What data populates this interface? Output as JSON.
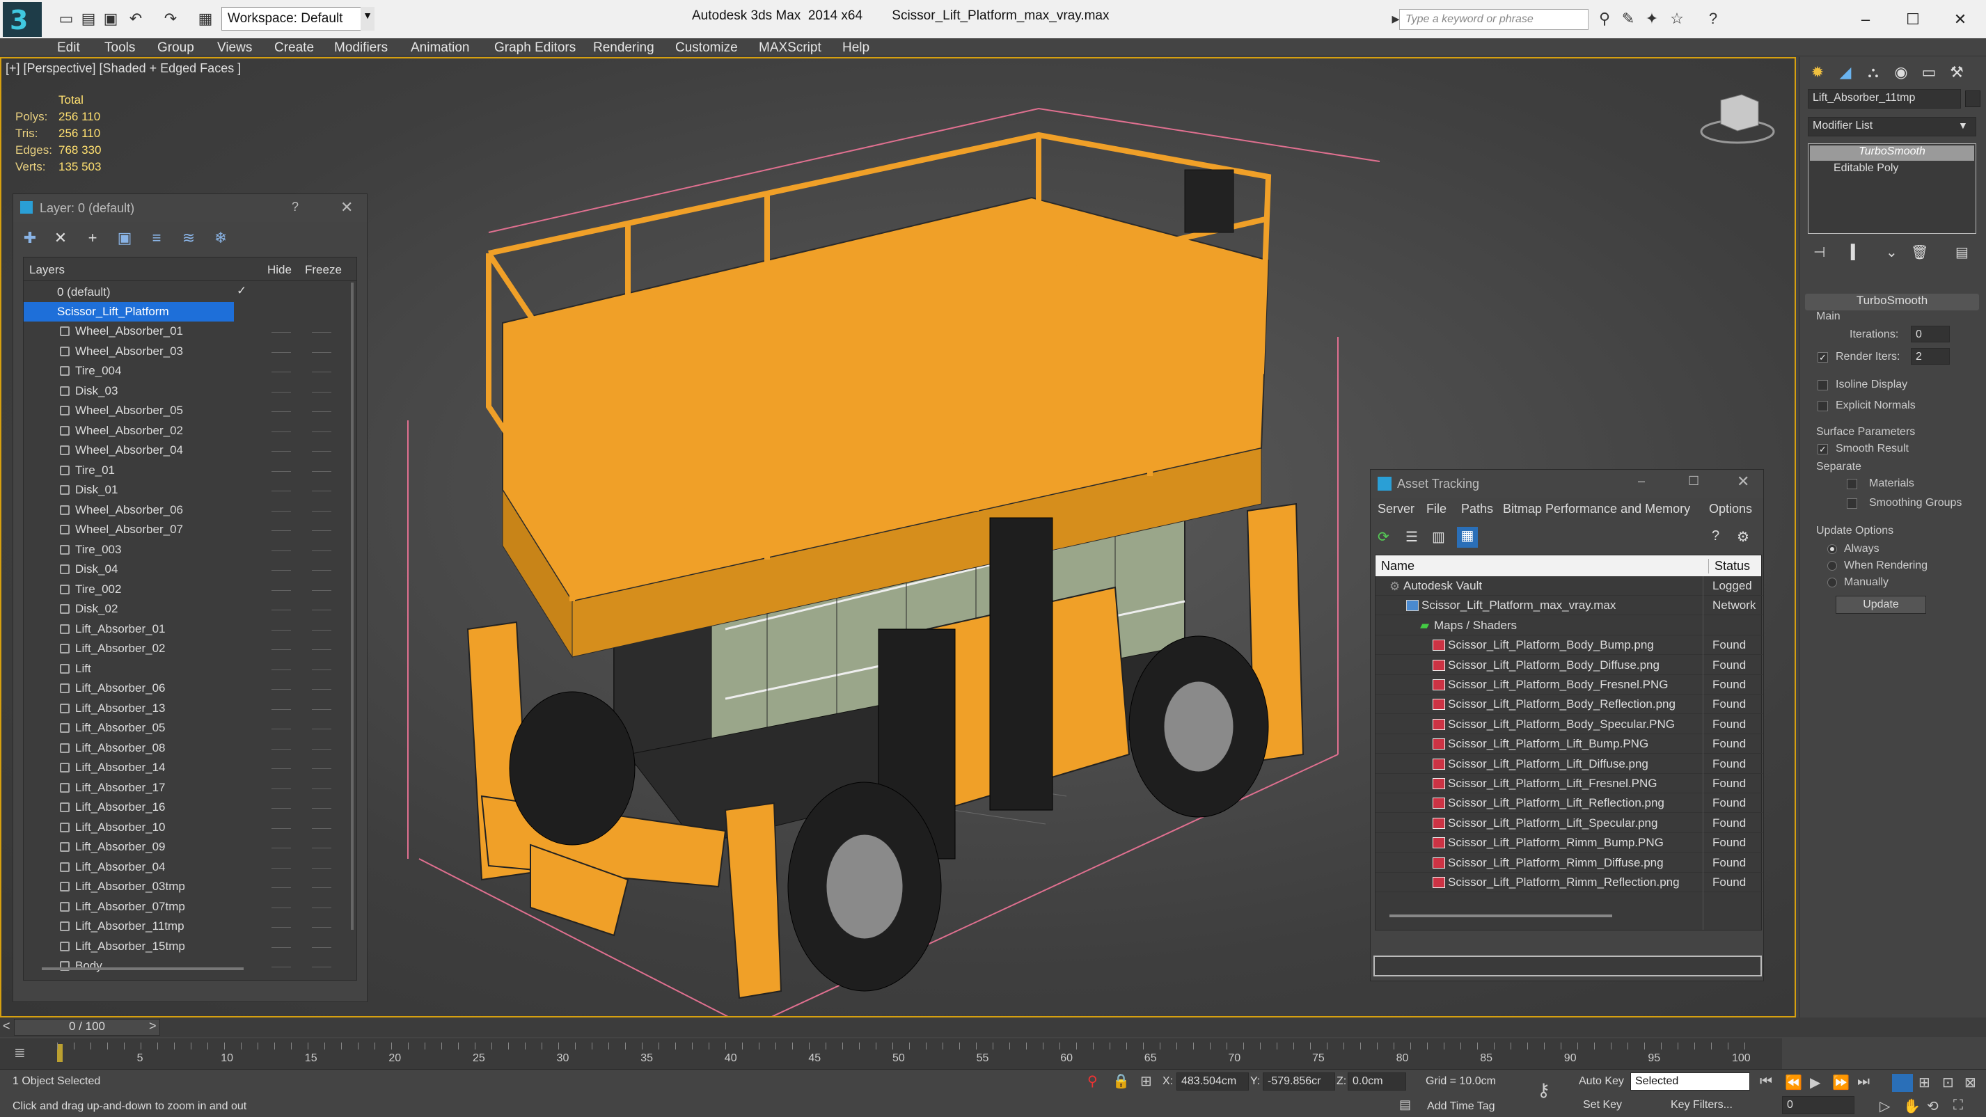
{
  "titlebar": {
    "logo": "3",
    "workspace": "Workspace: Default",
    "app": "Autodesk 3ds Max  2014 x64",
    "file": "Scissor_Lift_Platform_max_vray.max",
    "search_placeholder": "Type a keyword or phrase"
  },
  "menu": [
    "Edit",
    "Tools",
    "Group",
    "Views",
    "Create",
    "Modifiers",
    "Animation",
    "Graph Editors",
    "Rendering",
    "Customize",
    "MAXScript",
    "Help"
  ],
  "viewport": {
    "label": "[+] [Perspective] [Shaded + Edged Faces ]",
    "stats": {
      "total": "Total",
      "polys_label": "Polys:",
      "polys": "256 110",
      "tris_label": "Tris:",
      "tris": "256 110",
      "edges_label": "Edges:",
      "edges": "768 330",
      "verts_label": "Verts:",
      "verts": "135 503"
    }
  },
  "layer_panel": {
    "title": "Layer: 0 (default)",
    "help": "?",
    "col_layers": "Layers",
    "col_hide": "Hide",
    "col_freeze": "Freeze",
    "root": "0 (default)",
    "active_layer": "Scissor_Lift_Platform",
    "objects": [
      "Wheel_Absorber_01",
      "Wheel_Absorber_03",
      "Tire_004",
      "Disk_03",
      "Wheel_Absorber_05",
      "Wheel_Absorber_02",
      "Wheel_Absorber_04",
      "Tire_01",
      "Disk_01",
      "Wheel_Absorber_06",
      "Wheel_Absorber_07",
      "Tire_003",
      "Disk_04",
      "Tire_002",
      "Disk_02",
      "Lift_Absorber_01",
      "Lift_Absorber_02",
      "Lift",
      "Lift_Absorber_06",
      "Lift_Absorber_13",
      "Lift_Absorber_05",
      "Lift_Absorber_08",
      "Lift_Absorber_14",
      "Lift_Absorber_17",
      "Lift_Absorber_16",
      "Lift_Absorber_10",
      "Lift_Absorber_09",
      "Lift_Absorber_04",
      "Lift_Absorber_03tmp",
      "Lift_Absorber_07tmp",
      "Lift_Absorber_11tmp",
      "Lift_Absorber_15tmp",
      "Body"
    ]
  },
  "asset_tracking": {
    "title": "Asset Tracking",
    "menu": [
      "Server",
      "File",
      "Paths",
      "Bitmap Performance and Memory",
      "Options"
    ],
    "col_name": "Name",
    "col_status": "Status",
    "rows": [
      {
        "name": "Autodesk Vault",
        "status": "Logged"
      },
      {
        "name": "Scissor_Lift_Platform_max_vray.max",
        "status": "Network"
      },
      {
        "name": "Maps / Shaders",
        "status": ""
      },
      {
        "name": "Scissor_Lift_Platform_Body_Bump.png",
        "status": "Found"
      },
      {
        "name": "Scissor_Lift_Platform_Body_Diffuse.png",
        "status": "Found"
      },
      {
        "name": "Scissor_Lift_Platform_Body_Fresnel.PNG",
        "status": "Found"
      },
      {
        "name": "Scissor_Lift_Platform_Body_Reflection.png",
        "status": "Found"
      },
      {
        "name": "Scissor_Lift_Platform_Body_Specular.PNG",
        "status": "Found"
      },
      {
        "name": "Scissor_Lift_Platform_Lift_Bump.PNG",
        "status": "Found"
      },
      {
        "name": "Scissor_Lift_Platform_Lift_Diffuse.png",
        "status": "Found"
      },
      {
        "name": "Scissor_Lift_Platform_Lift_Fresnel.PNG",
        "status": "Found"
      },
      {
        "name": "Scissor_Lift_Platform_Lift_Reflection.png",
        "status": "Found"
      },
      {
        "name": "Scissor_Lift_Platform_Lift_Specular.png",
        "status": "Found"
      },
      {
        "name": "Scissor_Lift_Platform_Rimm_Bump.PNG",
        "status": "Found"
      },
      {
        "name": "Scissor_Lift_Platform_Rimm_Diffuse.png",
        "status": "Found"
      },
      {
        "name": "Scissor_Lift_Platform_Rimm_Reflection.png",
        "status": "Found"
      }
    ]
  },
  "command_panel": {
    "object_name": "Lift_Absorber_11tmp",
    "modifier_list": "Modifier List",
    "stack": [
      "TurboSmooth",
      "Editable Poly"
    ],
    "rollout_title": "TurboSmooth",
    "main": "Main",
    "iterations_label": "Iterations:",
    "iterations": "0",
    "render_iters_label": "Render Iters:",
    "render_iters": "2",
    "isoline": "Isoline Display",
    "explicit_normals": "Explicit Normals",
    "surface_params": "Surface Parameters",
    "smooth_result": "Smooth Result",
    "separate": "Separate",
    "materials": "Materials",
    "smoothing_groups": "Smoothing Groups",
    "update_options": "Update Options",
    "always": "Always",
    "when_rendering": "When Rendering",
    "manually": "Manually",
    "update_btn": "Update"
  },
  "timeline": {
    "frame": "0 / 100",
    "ticks": [
      "5",
      "10",
      "15",
      "20",
      "25",
      "30",
      "35",
      "40",
      "45",
      "50",
      "55",
      "60",
      "65",
      "70",
      "75",
      "80",
      "85",
      "90",
      "95",
      "100"
    ]
  },
  "statusbar": {
    "selected": "1 Object Selected",
    "hint": "Click and drag up-and-down to zoom in and out",
    "x_label": "X:",
    "x": "483.504cm",
    "y_label": "Y:",
    "y": "-579.856cr",
    "z_label": "Z:",
    "z": "0.0cm",
    "grid": "Grid = 10.0cm",
    "add_time_tag": "Add Time Tag",
    "auto_key": "Auto Key",
    "set_key": "Set Key",
    "selected_dropdown": "Selected",
    "key_filters": "Key Filters...",
    "frame_field": "0"
  }
}
